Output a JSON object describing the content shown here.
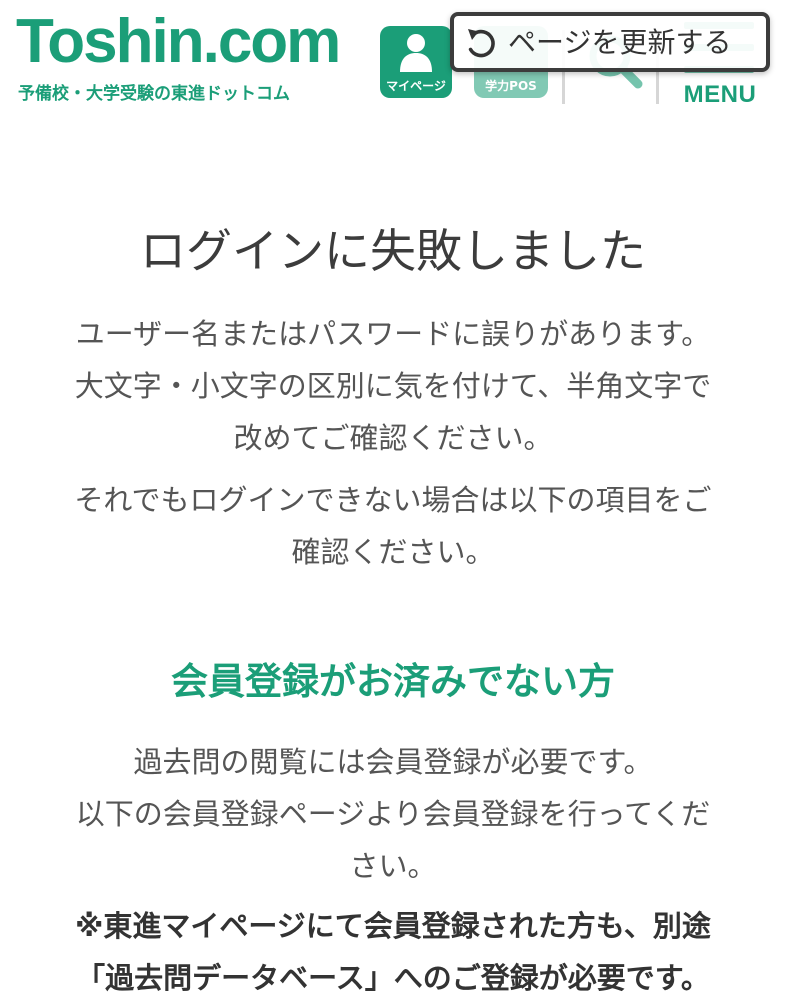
{
  "header": {
    "logo_text": "Toshin.com",
    "logo_subtitle": "予備校・大学受験の東進ドットコム",
    "mypage_label": "マイページ",
    "past_label": "学力POS",
    "menu_label": "MENU",
    "icons": {
      "mypage": "user-icon",
      "search": "search-icon",
      "menu": "hamburger-icon"
    }
  },
  "refresh": {
    "label": "ページを更新する",
    "icon": "refresh-icon"
  },
  "main": {
    "title": "ログインに失敗しました",
    "error_lines": [
      "ユーザー名またはパスワードに誤りがあります。",
      "大文字・小文字の区別に気を付けて、半角文字で",
      "改めてご確認ください。"
    ],
    "still_lines": [
      "それでもログインできない場合は以下の項目をご",
      "確認ください。"
    ],
    "member_heading": "会員登録がお済みでない方",
    "member_lines": [
      "過去問の閲覧には会員登録が必要です。",
      "以下の会員登録ページより会員登録を行ってくだ",
      "さい。"
    ],
    "note_lines": [
      "※東進マイページにて会員登録された方も、別途",
      "「過去問データベース」へのご登録が必要です。"
    ]
  },
  "colors": {
    "brand": "#1b9e78",
    "text": "#555555",
    "heading": "#3c3c3c"
  }
}
